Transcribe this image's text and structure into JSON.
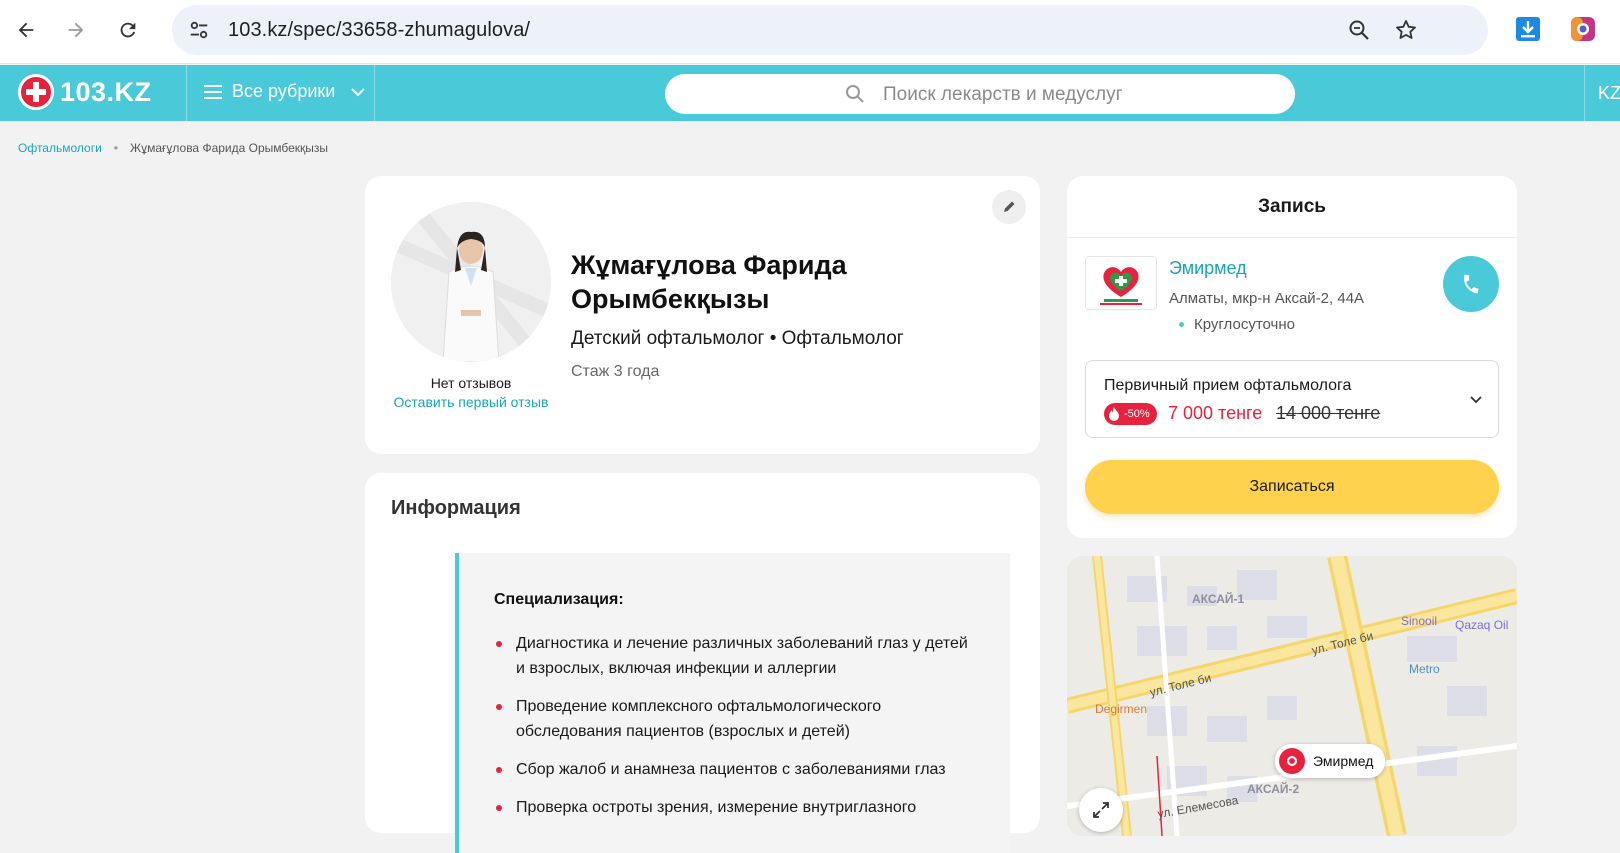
{
  "browser": {
    "url": "103.kz/spec/33658-zhumagulova/"
  },
  "header": {
    "logo_text": "103.KZ",
    "rubrics_label": "Все рубрики",
    "search_placeholder": "Поиск лекарств и медуслуг",
    "lang": "KZ"
  },
  "breadcrumb": {
    "parent": "Офтальмологи",
    "current": "Жұмағұлова Фарида Орымбекқызы"
  },
  "profile": {
    "name": "Жұмағұлова Фарида Орымбекқызы",
    "specialties": "Детский офтальмолог • Офтальмолог",
    "experience": "Стаж 3 года",
    "reviews_status": "Нет отзывов",
    "leave_review": "Оставить первый отзыв"
  },
  "info": {
    "title": "Информация",
    "subtitle": "Специализация:",
    "items": [
      "Диагностика и лечение различных заболеваний глаз у детей и взрослых, включая инфекции и аллергии",
      "Проведение комплексного офтальмологического обследования пациентов (взрослых и детей)",
      "Сбор жалоб и анамнеза пациентов с заболеваниями глаз",
      "Проверка остроты зрения, измерение внутриглазного"
    ]
  },
  "booking": {
    "title": "Запись",
    "clinic_name": "Эмирмед",
    "clinic_address": "Алматы, мкр-н Аксай-2, 44А",
    "clinic_hours": "Круглосуточно",
    "service_name": "Первичный прием офтальмолога",
    "discount": "-50%",
    "price_new": "7 000 тенге",
    "price_old": "14 000 тенге",
    "book_button": "Записаться"
  },
  "map": {
    "labels": {
      "aksai1": "АКСАЙ-1",
      "aksai2": "АКСАЙ-2",
      "tole_bi_1": "ул. Толе би",
      "tole_bi_2": "ул. Толе би",
      "elemesova": "ул. Елемесова",
      "sinooil": "Sinooil",
      "qazaq_oil": "Qazaq Oil",
      "metro": "Metro",
      "degirmen": "Degirmen",
      "marker": "Эмирмед"
    }
  },
  "colors": {
    "brand": "#4ac9d9",
    "accent_red": "#e6223e",
    "link": "#1ba5b5",
    "book_button": "#ffd24d"
  }
}
